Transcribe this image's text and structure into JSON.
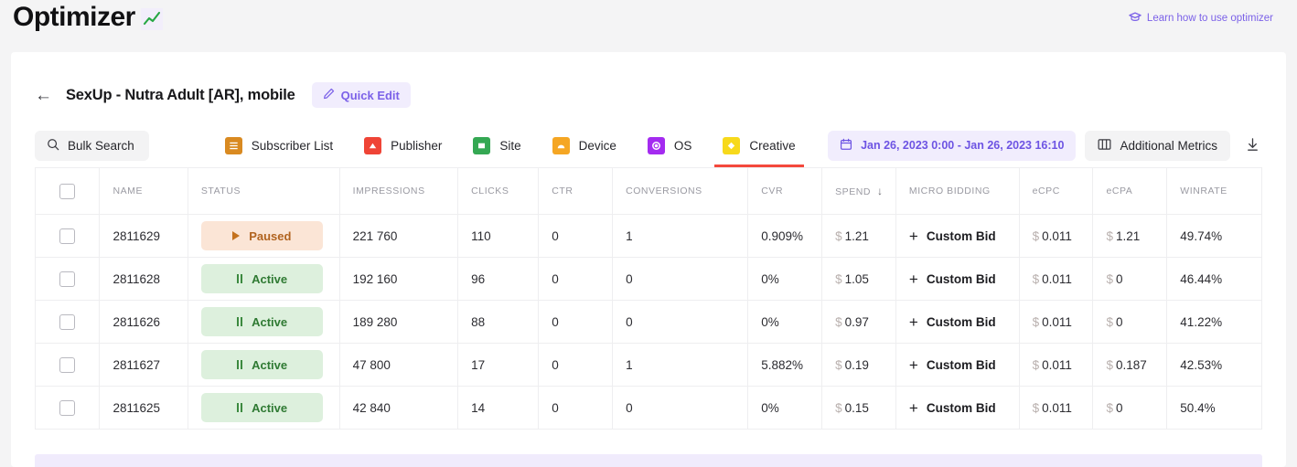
{
  "brand": {
    "name": "Optimizer",
    "chart_icon": "trend-up-icon",
    "accent": "#7b61e8"
  },
  "header": {
    "learn_link": "Learn how to use optimizer",
    "learn_icon": "graduation-cap-icon"
  },
  "campaign": {
    "back_icon": "arrow-left-icon",
    "title": "SexUp - Nutra Adult [AR], mobile",
    "quick_edit": "Quick Edit",
    "quick_edit_icon": "pencil-icon"
  },
  "toolbar": {
    "bulk_search": "Bulk Search",
    "bulk_search_icon": "search-icon",
    "tabs": [
      {
        "label": "Subscriber List",
        "icon": "list-icon",
        "color": "#d98a21",
        "active": false
      },
      {
        "label": "Publisher",
        "icon": "triangle-icon",
        "color": "#ef4436",
        "active": false
      },
      {
        "label": "Site",
        "icon": "square-icon",
        "color": "#34a853",
        "active": false
      },
      {
        "label": "Device",
        "icon": "dome-icon",
        "color": "#f5a623",
        "active": false
      },
      {
        "label": "OS",
        "icon": "circle-icon",
        "color": "#a42bf0",
        "active": false
      },
      {
        "label": "Creative",
        "icon": "diamond-icon",
        "color": "#f7d91b",
        "active": true
      }
    ],
    "date_range": "Jan 26, 2023 0:00 - Jan 26, 2023 16:10",
    "date_icon": "calendar-icon",
    "additional_metrics": "Additional Metrics",
    "additional_metrics_icon": "columns-icon",
    "download_icon": "download-icon",
    "active_tab_underline": "#f4483c"
  },
  "table": {
    "columns": [
      "NAME",
      "STATUS",
      "IMPRESSIONS",
      "CLICKS",
      "CTR",
      "CONVERSIONS",
      "CVR",
      "SPEND",
      "MICRO BIDDING",
      "eCPC",
      "eCPA",
      "WINRATE"
    ],
    "sorted_column": "SPEND",
    "sort_direction": "desc",
    "sort_icon": "arrow-down-icon",
    "currency_symbol": "$",
    "custom_bid_label": "Custom Bid",
    "rows": [
      {
        "name": "2811629",
        "status": "Paused",
        "status_kind": "paused",
        "impressions": "221 760",
        "clicks": "110",
        "ctr": "0",
        "conversions": "1",
        "cvr": "0.909%",
        "spend": "1.21",
        "ecpc": "0.011",
        "ecpa": "1.21",
        "winrate": "49.74%"
      },
      {
        "name": "2811628",
        "status": "Active",
        "status_kind": "active",
        "impressions": "192 160",
        "clicks": "96",
        "ctr": "0",
        "conversions": "0",
        "cvr": "0%",
        "spend": "1.05",
        "ecpc": "0.011",
        "ecpa": "0",
        "winrate": "46.44%"
      },
      {
        "name": "2811626",
        "status": "Active",
        "status_kind": "active",
        "impressions": "189 280",
        "clicks": "88",
        "ctr": "0",
        "conversions": "0",
        "cvr": "0%",
        "spend": "0.97",
        "ecpc": "0.011",
        "ecpa": "0",
        "winrate": "41.22%"
      },
      {
        "name": "2811627",
        "status": "Active",
        "status_kind": "active",
        "impressions": "47 800",
        "clicks": "17",
        "ctr": "0",
        "conversions": "1",
        "cvr": "5.882%",
        "spend": "0.19",
        "ecpc": "0.011",
        "ecpa": "0.187",
        "winrate": "42.53%"
      },
      {
        "name": "2811625",
        "status": "Active",
        "status_kind": "active",
        "impressions": "42 840",
        "clicks": "14",
        "ctr": "0",
        "conversions": "0",
        "cvr": "0%",
        "spend": "0.15",
        "ecpc": "0.011",
        "ecpa": "0",
        "winrate": "50.4%"
      }
    ]
  }
}
